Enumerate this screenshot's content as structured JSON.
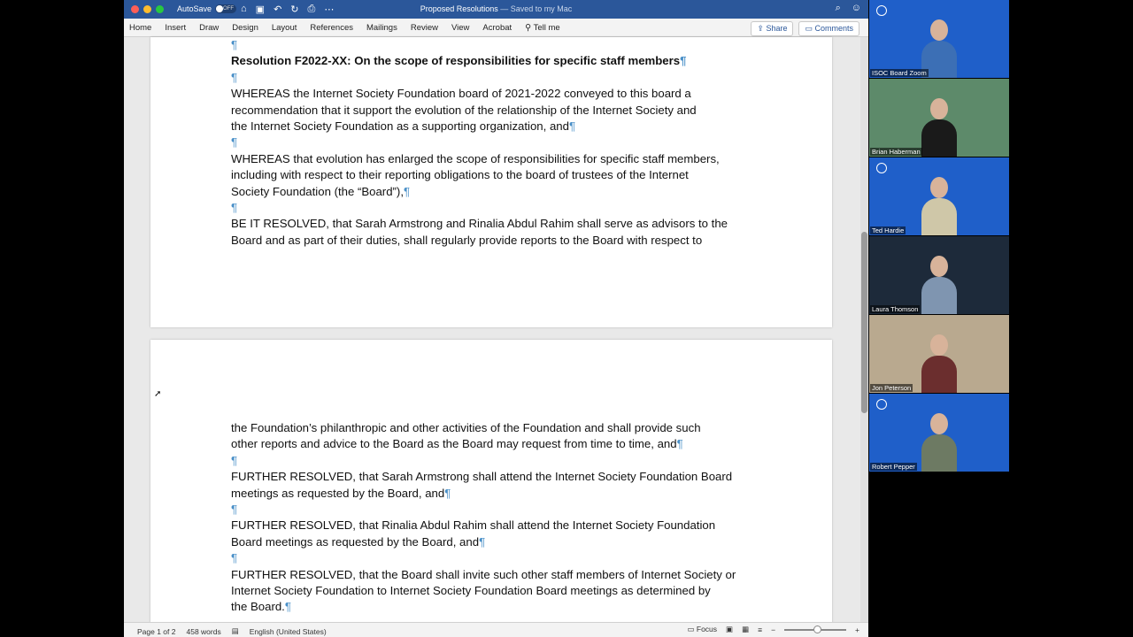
{
  "window": {
    "autosave_label": "AutoSave",
    "autosave_state": "OFF",
    "doc_title": "Proposed Resolutions",
    "doc_saved": "— Saved to my Mac"
  },
  "ribbon": {
    "tabs": [
      "Home",
      "Insert",
      "Draw",
      "Design",
      "Layout",
      "References",
      "Mailings",
      "Review",
      "View",
      "Acrobat",
      "Tell me"
    ],
    "share_label": "Share",
    "comments_label": "Comments"
  },
  "document": {
    "page1_lines": [
      {
        "text": "",
        "pilcrow": true
      },
      {
        "text": "Resolution F2022-XX: On the scope of responsibilities for specific staff members",
        "pilcrow": true,
        "bold": true
      },
      {
        "text": "",
        "pilcrow": true
      },
      {
        "text": "WHEREAS the Internet Society Foundation board of 2021-2022 conveyed to this board a",
        "pilcrow": false
      },
      {
        "text": "recommendation that it support the evolution of the relationship of the Internet Society and",
        "pilcrow": false
      },
      {
        "text": "the Internet Society Foundation as a supporting organization, and",
        "pilcrow": true
      },
      {
        "text": "",
        "pilcrow": true
      },
      {
        "text": "WHEREAS that evolution has enlarged the scope of responsibilities for specific staff members,",
        "pilcrow": false
      },
      {
        "text": "including with respect to their reporting obligations to the board of trustees of the Internet",
        "pilcrow": false
      },
      {
        "text": "Society Foundation (the “Board”),",
        "pilcrow": true
      },
      {
        "text": "",
        "pilcrow": true
      },
      {
        "text": "BE IT RESOLVED, that Sarah Armstrong and Rinalia Abdul Rahim shall serve as advisors to the",
        "pilcrow": false
      },
      {
        "text": "Board and as part of their duties, shall regularly provide reports to the Board with respect to",
        "pilcrow": false
      }
    ],
    "page2_lines": [
      {
        "text": "the Foundation’s philanthropic and other activities of the Foundation and shall provide such",
        "pilcrow": false
      },
      {
        "text": "other reports and advice to the Board as the Board may request from time to time, and",
        "pilcrow": true
      },
      {
        "text": "",
        "pilcrow": true
      },
      {
        "text": "FURTHER RESOLVED, that Sarah Armstrong shall attend the Internet Society Foundation Board",
        "pilcrow": false
      },
      {
        "text": "meetings as requested by the Board, and",
        "pilcrow": true
      },
      {
        "text": "",
        "pilcrow": true
      },
      {
        "text": "FURTHER RESOLVED, that Rinalia Abdul Rahim shall attend the Internet Society Foundation",
        "pilcrow": false
      },
      {
        "text": "Board meetings as requested by the Board, and",
        "pilcrow": true
      },
      {
        "text": "",
        "pilcrow": true
      },
      {
        "text": "FURTHER RESOLVED, that the Board shall invite such other staff members of Internet Society or",
        "pilcrow": false
      },
      {
        "text": "Internet Society Foundation to Internet Society Foundation Board meetings as determined by",
        "pilcrow": false
      },
      {
        "text": "the Board.",
        "pilcrow": true
      }
    ]
  },
  "status": {
    "page": "Page 1 of 2",
    "words": "458 words",
    "language": "English (United States)",
    "focus": "Focus"
  },
  "participants": [
    {
      "name": "ISOC Board Zoom",
      "bg": "#1f5fc9",
      "shirt": "#3c6fb5",
      "logo": true
    },
    {
      "name": "Brian Haberman",
      "bg": "#5d8a6a",
      "shirt": "#1a1a1a",
      "logo": false
    },
    {
      "name": "Ted Hardie",
      "bg": "#1f5fc9",
      "shirt": "#cfc7a8",
      "logo": true
    },
    {
      "name": "Laura Thomson",
      "bg": "#1d2a3a",
      "shirt": "#7f95b0",
      "logo": false
    },
    {
      "name": "Jon Peterson",
      "bg": "#b9a98f",
      "shirt": "#6b2e2e",
      "logo": false
    },
    {
      "name": "Robert Pepper",
      "bg": "#1f5fc9",
      "shirt": "#6d7a63",
      "logo": true
    }
  ],
  "colors": {
    "word_blue": "#2b579a",
    "pilcrow": "#4a90c8",
    "zoom_blue": "#1f5fc9"
  }
}
